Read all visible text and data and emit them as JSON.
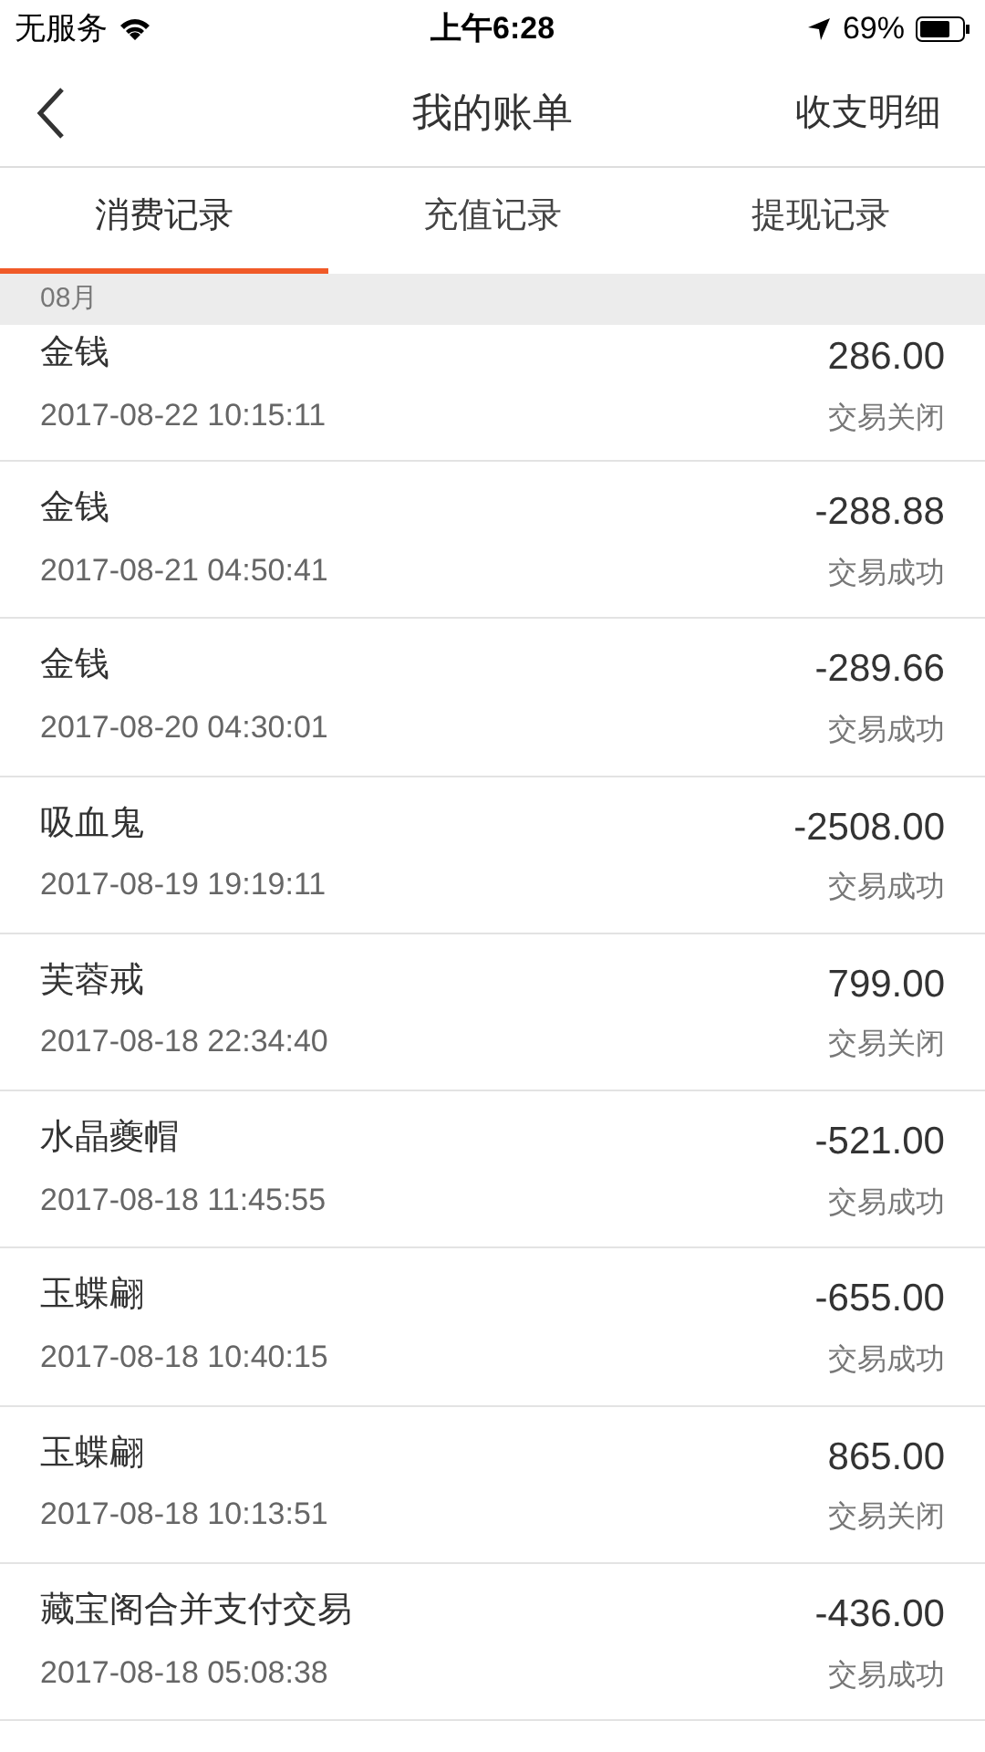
{
  "status_bar": {
    "carrier": "无服务",
    "time": "上午6:28",
    "battery": "69%"
  },
  "nav": {
    "title": "我的账单",
    "action": "收支明细"
  },
  "tabs": [
    {
      "label": "消费记录",
      "selected": true
    },
    {
      "label": "充值记录",
      "selected": false
    },
    {
      "label": "提现记录",
      "selected": false
    }
  ],
  "section": {
    "title": "08月"
  },
  "records": [
    {
      "name": "金钱",
      "time": "2017-08-22 10:15:11",
      "amount": "286.00",
      "status": "交易关闭"
    },
    {
      "name": "金钱",
      "time": "2017-08-21 04:50:41",
      "amount": "-288.88",
      "status": "交易成功"
    },
    {
      "name": "金钱",
      "time": "2017-08-20 04:30:01",
      "amount": "-289.66",
      "status": "交易成功"
    },
    {
      "name": "吸血鬼",
      "time": "2017-08-19 19:19:11",
      "amount": "-2508.00",
      "status": "交易成功"
    },
    {
      "name": "芙蓉戒",
      "time": "2017-08-18 22:34:40",
      "amount": "799.00",
      "status": "交易关闭"
    },
    {
      "name": "水晶夔帽",
      "time": "2017-08-18 11:45:55",
      "amount": "-521.00",
      "status": "交易成功"
    },
    {
      "name": "玉蝶翩",
      "time": "2017-08-18 10:40:15",
      "amount": "-655.00",
      "status": "交易成功"
    },
    {
      "name": "玉蝶翩",
      "time": "2017-08-18 10:13:51",
      "amount": "865.00",
      "status": "交易关闭"
    },
    {
      "name": "藏宝阁合并支付交易",
      "time": "2017-08-18 05:08:38",
      "amount": "-436.00",
      "status": "交易成功"
    }
  ]
}
